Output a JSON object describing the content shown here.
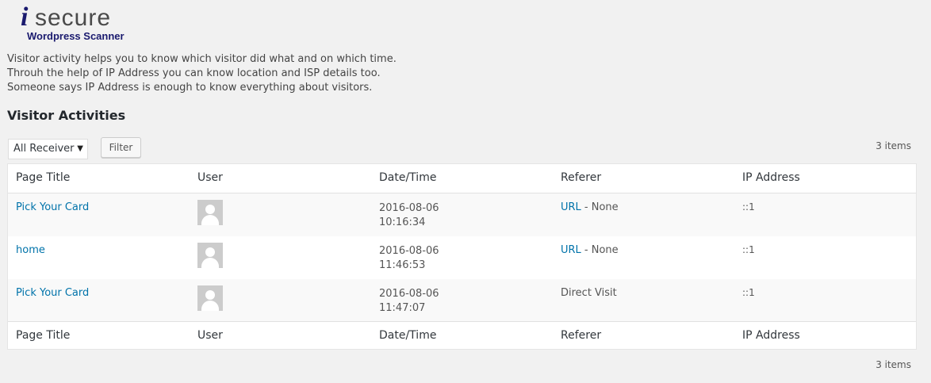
{
  "logo": {
    "brand": "isecure",
    "subtitle": "Wordpress Scanner"
  },
  "intro": [
    "Visitor activity helps you to know which visitor did what and on which time.",
    "Throuh the help of IP Address you can know location and ISP details too.",
    "Someone says IP Address is enough to know everything about visitors."
  ],
  "section_title": "Visitor Activities",
  "filter": {
    "select_value": "All Receiver",
    "button_label": "Filter"
  },
  "item_count": "3 items",
  "columns": [
    "Page Title",
    "User",
    "Date/Time",
    "Referer",
    "IP Address"
  ],
  "rows": [
    {
      "page_title": "Pick Your Card",
      "date": "2016-08-06",
      "time": "10:16:34",
      "referer_link": "URL",
      "referer_text": " - None",
      "ip": "::1"
    },
    {
      "page_title": "home",
      "date": "2016-08-06",
      "time": "11:46:53",
      "referer_link": "URL",
      "referer_text": " - None",
      "ip": "::1"
    },
    {
      "page_title": "Pick Your Card",
      "date": "2016-08-06",
      "time": "11:47:07",
      "referer_link": "",
      "referer_text": "Direct Visit",
      "ip": "::1"
    }
  ],
  "colors": {
    "link": "#0073aa",
    "background": "#f1f1f1",
    "logo_dark": "#1a1a6e",
    "logo_gray": "#4a4a4a"
  }
}
